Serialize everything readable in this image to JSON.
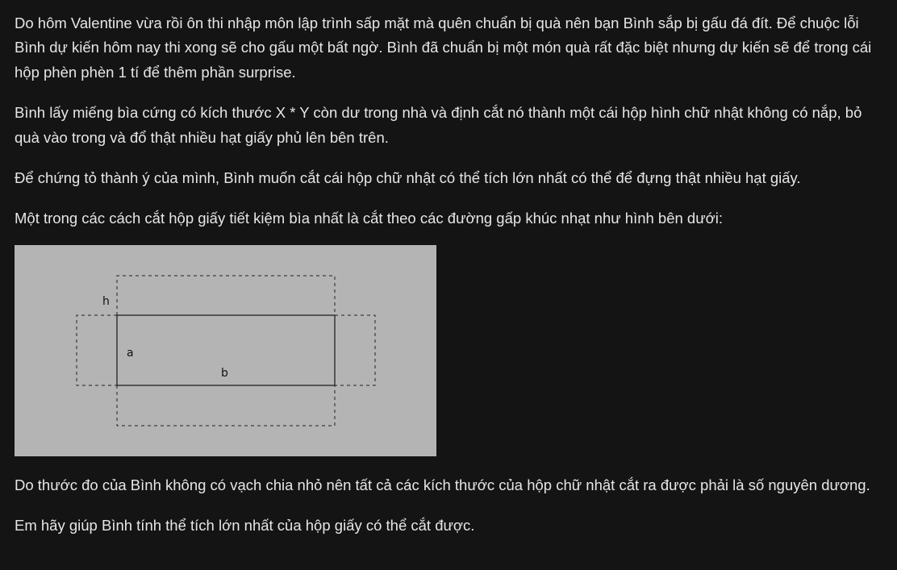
{
  "problem": {
    "paragraphs": [
      "Do hôm Valentine vừa rồi ôn thi nhập môn lập trình sấp mặt mà quên chuẩn bị quà nên bạn Bình sắp bị gấu đá đít. Để chuộc lỗi Bình dự kiến hôm nay thi xong sẽ cho gấu một bất ngờ. Bình đã chuẩn bị một món quà rất đặc biệt nhưng dự kiến sẽ để trong cái hộp phèn phèn 1 tí để thêm phần surprise.",
      "Bình lấy miếng bìa cứng có kích thước X * Y còn dư trong nhà và định cắt nó thành một cái hộp hình chữ nhật không có nắp, bỏ quà vào trong và đổ thật nhiều hạt giấy phủ lên bên trên.",
      "Để chứng tỏ thành ý của mình, Bình muốn cắt cái hộp chữ nhật có thể tích lớn nhất có thể để đựng thật nhiều hạt giấy.",
      "Một trong các cách cắt hộp giấy tiết kiệm bìa nhất là cắt theo các đường gấp khúc nhạt như hình bên dưới:",
      "Do thước đo của Bình không có vạch chia nhỏ nên tất cả các kích thước của hộp chữ nhật cắt ra được phải là số nguyên dương.",
      "Em hãy giúp Bình tính thể tích lớn nhất của hộp giấy có thể cắt được."
    ],
    "figure": {
      "label_h": "h",
      "label_a": "a",
      "label_b": "b"
    }
  }
}
